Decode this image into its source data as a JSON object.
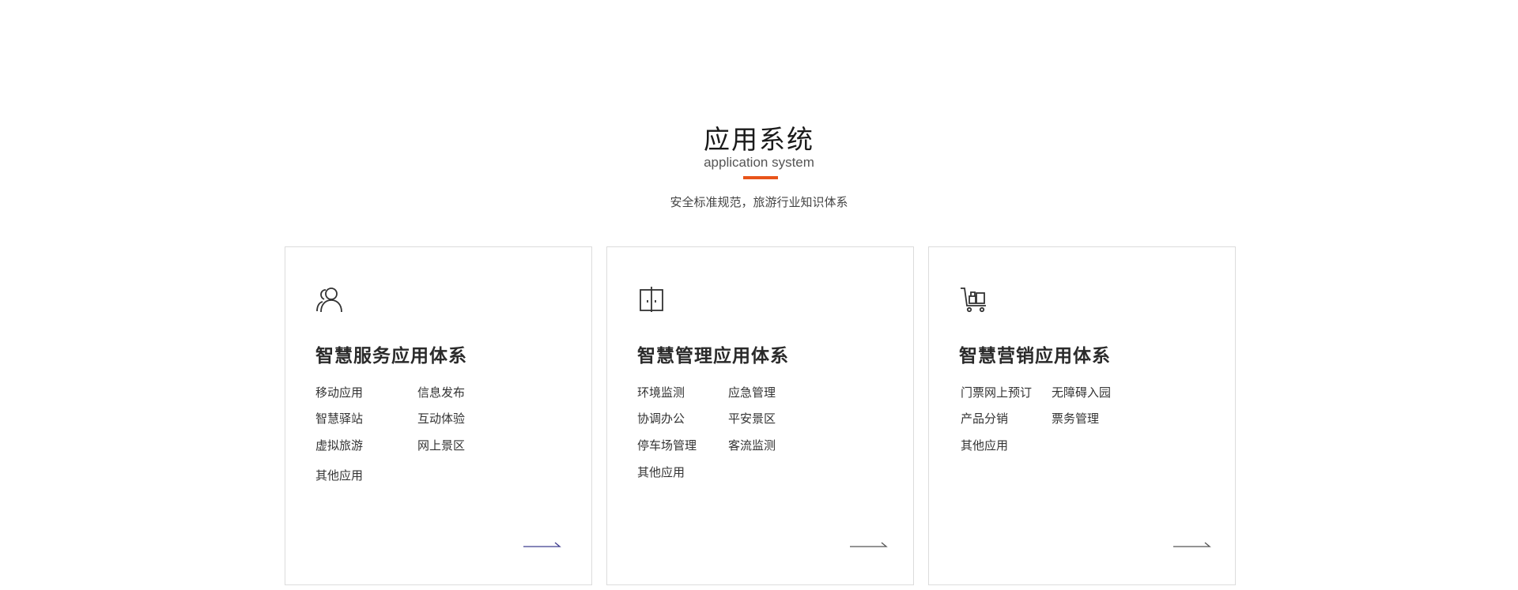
{
  "section": {
    "title": "应用系统",
    "subtitle": "application system",
    "description": "安全标准规范，旅游行业知识体系",
    "accent_color": "#e8541a"
  },
  "cards": [
    {
      "icon": "user-icon",
      "title": "智慧服务应用体系",
      "items": [
        "移动应用",
        "信息发布",
        "智慧驿站",
        "互动体验",
        "虚拟旅游",
        "网上景区",
        "其他应用"
      ],
      "arrow_color": "#3f3d8f"
    },
    {
      "icon": "door-icon",
      "title": "智慧管理应用体系",
      "items": [
        "环境监测",
        "应急管理",
        "协调办公",
        "平安景区",
        "停车场管理",
        "客流监测",
        "其他应用"
      ],
      "arrow_color": "#555555"
    },
    {
      "icon": "cart-icon",
      "title": "智慧营销应用体系",
      "items": [
        "门票网上预订",
        "无障碍入园",
        "产品分销",
        "票务管理",
        "其他应用"
      ],
      "arrow_color": "#555555"
    }
  ]
}
